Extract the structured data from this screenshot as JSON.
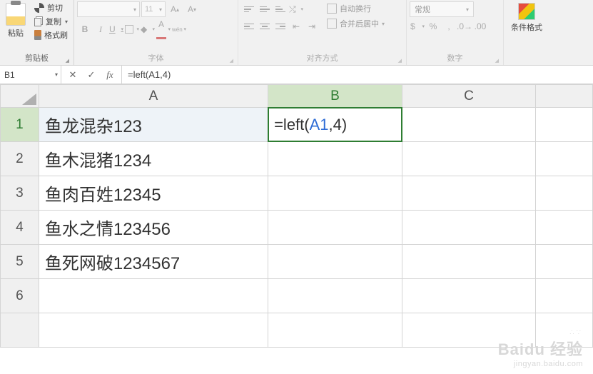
{
  "ribbon": {
    "clipboard": {
      "label": "剪贴板",
      "paste": "粘贴",
      "cut": "剪切",
      "copy": "复制",
      "format_painter": "格式刷"
    },
    "font": {
      "label": "字体",
      "font_name": "",
      "font_size": "11"
    },
    "alignment": {
      "label": "对齐方式",
      "wrap": "自动换行",
      "merge": "合并后居中"
    },
    "number": {
      "label": "数字",
      "format": "常规"
    },
    "styles": {
      "cond_format": "条件格式"
    }
  },
  "formula_bar": {
    "name_box": "B1",
    "formula": "=left(A1,4)"
  },
  "columns": [
    "A",
    "B",
    "C"
  ],
  "rows": [
    {
      "n": "1",
      "a": "鱼龙混杂123",
      "b_prefix": "=left(",
      "b_ref": "A1",
      "b_suffix": ",4)"
    },
    {
      "n": "2",
      "a": "鱼木混猪1234"
    },
    {
      "n": "3",
      "a": "鱼肉百姓12345"
    },
    {
      "n": "4",
      "a": "鱼水之情123456"
    },
    {
      "n": "5",
      "a": "鱼死网破1234567"
    },
    {
      "n": "6",
      "a": ""
    }
  ],
  "watermark": {
    "brand": "Baidu 经验",
    "url": "jingyan.baidu.com"
  }
}
